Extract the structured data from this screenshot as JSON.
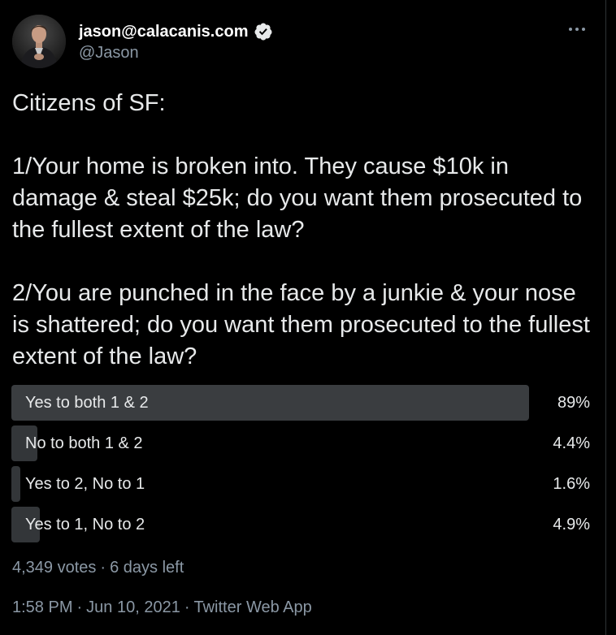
{
  "author": {
    "display_name": "jason@calacanis.com",
    "handle": "@Jason",
    "verified": true
  },
  "tweet": {
    "text": "Citizens of SF:\n\n1/Your home is broken into. They cause $10k in damage & steal $25k; do you want them prosecuted to the fullest extent of the law?\n\n2/You are punched in the face by a junkie & your nose is shattered; do you want them prosecuted to the fullest extent of the law?"
  },
  "poll": {
    "options": [
      {
        "label": "Yes to both 1 & 2",
        "percent_text": "89%",
        "percent": 89,
        "winner": true
      },
      {
        "label": "No to both 1 & 2",
        "percent_text": "4.4%",
        "percent": 4.4,
        "winner": false
      },
      {
        "label": "Yes to 2, No to 1",
        "percent_text": "1.6%",
        "percent": 1.6,
        "winner": false
      },
      {
        "label": "Yes to 1, No to 2",
        "percent_text": "4.9%",
        "percent": 4.9,
        "winner": false
      }
    ],
    "votes": "4,349 votes",
    "separator": "·",
    "time_left": "6 days left"
  },
  "meta": {
    "time": "1:58 PM",
    "separator": "·",
    "date": "Jun 10, 2021",
    "source": "Twitter Web App"
  },
  "icons": {
    "verified": "verified-badge-icon",
    "more": "more-dots-icon"
  },
  "colors": {
    "background": "#000000",
    "text_primary": "#e7e9ea",
    "text_secondary": "#8b98a5",
    "poll_bar": "#333639"
  }
}
